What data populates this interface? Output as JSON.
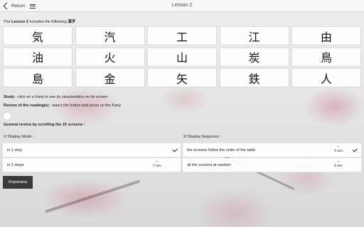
{
  "header": {
    "return_label": "Return",
    "title": "Lesson 2"
  },
  "intro": {
    "prefix": "The ",
    "lesson": "Lesson 2",
    "middle": " includes the following ",
    "kanji_word": "漢字"
  },
  "kanji": [
    "気",
    "汽",
    "工",
    "江",
    "由",
    "油",
    "火",
    "山",
    "炭",
    "鳥",
    "島",
    "金",
    "矢",
    "鉄",
    "人"
  ],
  "instructions": {
    "study_label": "Study",
    "study_text": " : click on a Kanji to see its caracteristics on its screen",
    "review_label": "Review of the reading(s)",
    "review_text": " : select the button and press on the Kanji",
    "general_review": "General review by scrolling the 15 screens :"
  },
  "display_mode": {
    "title": "1/ Display Mode :",
    "options": [
      {
        "label": "in 1 step",
        "selected": true
      },
      {
        "label": "in 2 steps",
        "value": "2 sec",
        "selected": false
      }
    ]
  },
  "display_sequence": {
    "title": "2/ Display Sequence :",
    "options": [
      {
        "label": "the screens follow the order of the table",
        "value": "4 sec",
        "selected": true
      },
      {
        "label": "all the screens at random",
        "value": "4 sec",
        "selected": false
      }
    ]
  },
  "diaporama_label": "Diaporama",
  "colors": {
    "topbar": "#f7f7f7",
    "button_dark": "#3a3a3a",
    "blossom_pink": "#c87a8c"
  },
  "icons": {
    "back": "chevron-left-icon",
    "menu": "hamburger-menu-icon",
    "check": "check-icon",
    "speaker": "circle-button"
  }
}
